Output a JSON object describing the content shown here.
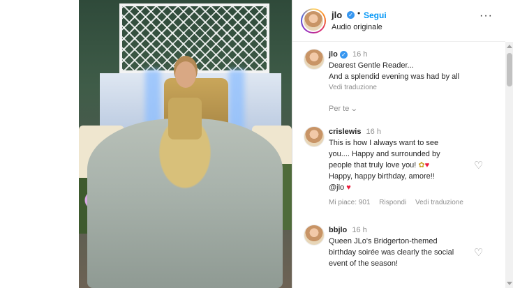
{
  "post": {
    "username": "jlo",
    "follow_label": "Segui",
    "dot": "•",
    "audio": "Audio originale",
    "more": "···"
  },
  "caption": {
    "author": "jlo",
    "time": "16 h",
    "lines": [
      "Dearest Gentle Reader...",
      "And a splendid evening was had by all"
    ],
    "translate": "Vedi traduzione"
  },
  "sort_label": "Per te",
  "comments": [
    {
      "author": "crislewis",
      "time": "16 h",
      "lines": [
        "This is how I always want to see",
        "you.... Happy and surrounded by",
        "people that truly love you! ",
        "Happy, happy birthday, amore!!",
        "@jlo "
      ],
      "likes": "Mi piace: 901",
      "reply": "Rispondi",
      "translate": "Vedi traduzione"
    },
    {
      "author": "bbjlo",
      "time": "16 h",
      "lines": [
        "Queen JLo's Bridgerton-themed",
        "birthday soirée was clearly the social",
        "event of the season!"
      ]
    }
  ],
  "icons": {
    "heart": "♡",
    "red_heart": "♥",
    "bouquet": "✿",
    "chevron": "⌄",
    "verified": "✓"
  },
  "colors": {
    "link": "#0095f6",
    "verified": "#3897f0",
    "muted": "#8e8e8e"
  }
}
